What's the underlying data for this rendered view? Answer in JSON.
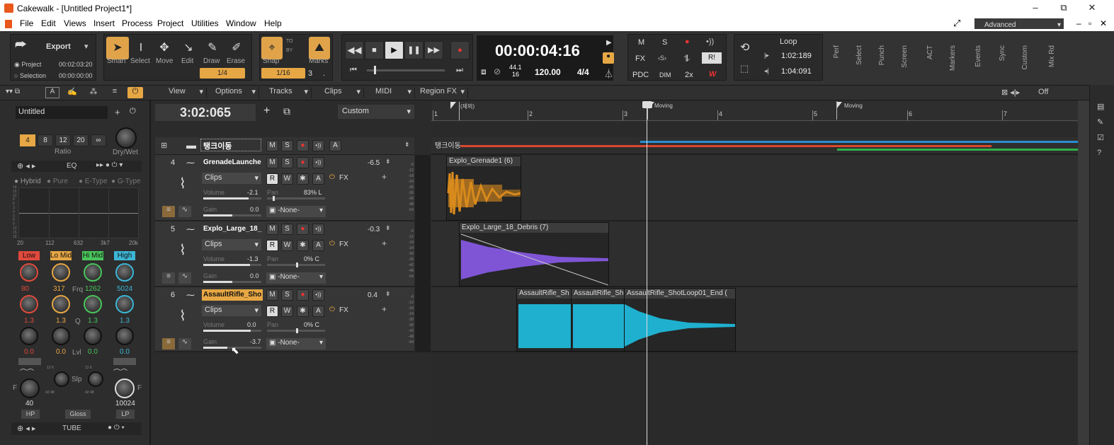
{
  "window": {
    "title": "Cakewalk - [Untitled Project1*]",
    "controls": [
      "–",
      "⧉",
      "✕"
    ],
    "mdi_controls": [
      "–",
      "▫",
      "✕"
    ]
  },
  "menu": [
    "File",
    "Edit",
    "Views",
    "Insert",
    "Process",
    "Project",
    "Utilities",
    "Window",
    "Help"
  ],
  "workspace": {
    "label": "Advanced"
  },
  "toolbar": {
    "export": {
      "label": "Export",
      "project_label": "Project",
      "project_time": "00:02:03:20",
      "selection_label": "Selection",
      "selection_time": "00:00:00:00"
    },
    "tools": {
      "smart": "Smart",
      "select": "Select",
      "move": "Move",
      "edit": "Edit",
      "draw": "Draw",
      "erase": "Erase",
      "snap_value": "1/4"
    },
    "snap": {
      "label": "Snap",
      "to": "TO",
      "by": "BY",
      "value": "1/16",
      "marks": "Marks",
      "marks_count": "3",
      "dot": "."
    },
    "transport": {
      "time": "00:00:04:16",
      "rate_top": "44.1",
      "rate_bottom": "16",
      "tempo": "120.00",
      "meter": "4/4"
    },
    "mix": {
      "m": "M",
      "s": "S",
      "fx": "FX",
      "pdc": "PDC",
      "dim": "DIM",
      "x2": "2x",
      "r": "R!",
      "w": "W"
    },
    "loop": {
      "label": "Loop",
      "start": "1:02:189",
      "end": "1:04:091"
    },
    "tabs": [
      "Perf",
      "Select",
      "Punch",
      "Screen",
      "ACT",
      "Markers",
      "Events",
      "Sync",
      "Custom",
      "Mix Rd"
    ]
  },
  "subbar": {
    "view": "View",
    "options": "Options",
    "tracks": "Tracks",
    "clips": "Clips",
    "midi": "MIDI",
    "region_fx": "Region FX",
    "off": "Off"
  },
  "inspector": {
    "preset": "Untitled",
    "ratio_buttons": [
      "4",
      "8",
      "12",
      "20",
      "∞"
    ],
    "ratio_label": "Ratio",
    "drywet_label": "Dry/Wet",
    "eq_label": "EQ",
    "modes": [
      "Hybrid",
      "Pure",
      "E-Type",
      "G-Type"
    ],
    "eq_y_labels": [
      "18",
      "15",
      "12",
      "9",
      "6",
      "3",
      "0",
      "3",
      "6",
      "9",
      "12",
      "15",
      "18"
    ],
    "eq_x_labels": [
      "20",
      "112",
      "632",
      "3k7",
      "20k"
    ],
    "bands": [
      {
        "name": "Low",
        "color": "#e04a3c",
        "freq": "80",
        "q": "1.3",
        "lvl": "0.0"
      },
      {
        "name": "Lo Mid",
        "color": "#e7a744",
        "freq": "317",
        "q": "1.3",
        "lvl": "0.0"
      },
      {
        "name": "Hi Mid",
        "color": "#49c55b",
        "freq": "1262",
        "q": "1.3",
        "lvl": "0.0"
      },
      {
        "name": "High",
        "color": "#3cb6d6",
        "freq": "5024",
        "q": "1.3",
        "lvl": "0.0"
      }
    ],
    "frq_label": "Frq",
    "q_label": "Q",
    "lvl_label": "Lvl",
    "slp_label": "Slp",
    "f_label": "F",
    "hp_value": "40",
    "lp_value": "10024",
    "hp": "HP",
    "gloss": "Gloss",
    "lp": "LP",
    "tube": "TUBE",
    "slp_scales": [
      "12",
      "6",
      "24",
      "36",
      "48",
      "42",
      "48"
    ]
  },
  "timecode": "3:02:065",
  "track_filter": "Custom",
  "folder": {
    "name": "탱크이동",
    "m": "M",
    "s": "S",
    "a": "A"
  },
  "tracks": [
    {
      "num": "4",
      "name": "GrenadeLaunche",
      "db": "-6.5",
      "clips": "Clips",
      "volume_label": "Volume",
      "volume": "-2.1",
      "volume_pos": 0.78,
      "pan_label": "Pan",
      "pan": "83% L",
      "pan_pos": 0.1,
      "gain_label": "Gain",
      "gain": "0.0",
      "gain_pos": 0.5,
      "input": "-None-",
      "fx": "FX",
      "m": "M",
      "s": "S",
      "r": "R",
      "w": "W",
      "a": "A"
    },
    {
      "num": "5",
      "name": "Explo_Large_18_",
      "db": "-0.3",
      "clips": "Clips",
      "volume_label": "Volume",
      "volume": "-1.3",
      "volume_pos": 0.8,
      "pan_label": "Pan",
      "pan": "0% C",
      "pan_pos": 0.5,
      "gain_label": "Gain",
      "gain": "0.0",
      "gain_pos": 0.5,
      "input": "-None-",
      "fx": "FX",
      "m": "M",
      "s": "S",
      "r": "R",
      "w": "W",
      "a": "A"
    },
    {
      "num": "6",
      "name": "AssaultRifle_Sho",
      "db": "0.4",
      "clips": "Clips",
      "volume_label": "Volume",
      "volume": "0.0",
      "volume_pos": 0.82,
      "pan_label": "Pan",
      "pan": "0% C",
      "pan_pos": 0.5,
      "gain_label": "Gain",
      "gain": "-3.7",
      "gain_pos": 0.42,
      "input": "-None-",
      "fx": "FX",
      "m": "M",
      "s": "S",
      "r": "R",
      "w": "W",
      "a": "A"
    }
  ],
  "meter_scale": [
    "-6",
    "-12",
    "-18",
    "-24",
    "-30",
    "-36",
    "-42",
    "-48",
    "-54"
  ],
  "ruler": {
    "bars": [
      "1",
      "2",
      "3",
      "4",
      "5",
      "6",
      "7"
    ],
    "markers": [
      "(제외)",
      "Moving",
      "Moving"
    ],
    "plus": "+"
  },
  "lanes": {
    "folder_clip": "탱크이동",
    "clips": [
      "Explo_Grenade1 (6)",
      "Explo_Large_18_Debris (7)",
      "AssaultRifle_Sh",
      "AssaultRifle_Sh",
      "AssaultRifle_ShotLoop01_End ("
    ]
  },
  "colors": {
    "accent": "#e7a744",
    "track4_wave": "#d88a1c",
    "track5_wave": "#7f55d6",
    "track6_wave": "#1fb0cf"
  }
}
